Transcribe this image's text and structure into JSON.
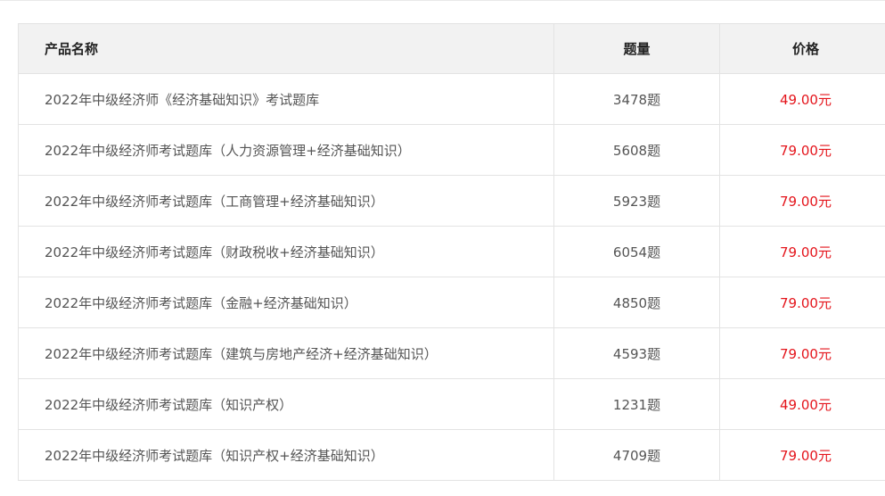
{
  "table": {
    "headers": {
      "name": "产品名称",
      "count": "题量",
      "price": "价格"
    },
    "rows": [
      {
        "name": "2022年中级经济师《经济基础知识》考试题库",
        "count": "3478题",
        "price": "49.00元"
      },
      {
        "name": "2022年中级经济师考试题库（人力资源管理+经济基础知识）",
        "count": "5608题",
        "price": "79.00元"
      },
      {
        "name": "2022年中级经济师考试题库（工商管理+经济基础知识）",
        "count": "5923题",
        "price": "79.00元"
      },
      {
        "name": "2022年中级经济师考试题库（财政税收+经济基础知识）",
        "count": "6054题",
        "price": "79.00元"
      },
      {
        "name": "2022年中级经济师考试题库（金融+经济基础知识）",
        "count": "4850题",
        "price": "79.00元"
      },
      {
        "name": "2022年中级经济师考试题库（建筑与房地产经济+经济基础知识）",
        "count": "4593题",
        "price": "79.00元"
      },
      {
        "name": "2022年中级经济师考试题库（知识产权）",
        "count": "1231题",
        "price": "49.00元"
      },
      {
        "name": "2022年中级经济师考试题库（知识产权+经济基础知识）",
        "count": "4709题",
        "price": "79.00元"
      }
    ]
  },
  "colors": {
    "header_bg": "#f2f2f2",
    "border": "#e3e3e3",
    "text": "#555555",
    "header_text": "#222222",
    "price": "#e4141b"
  }
}
